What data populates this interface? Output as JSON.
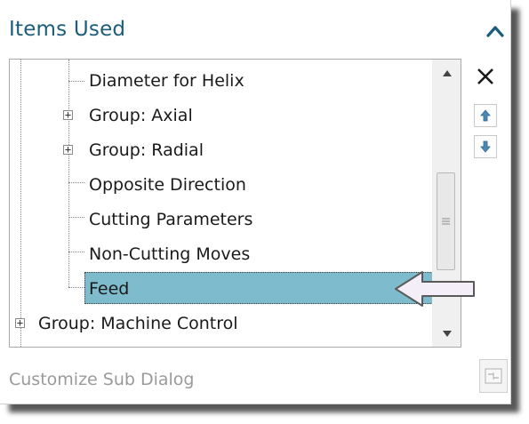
{
  "panel": {
    "title": "Items Used"
  },
  "tree": {
    "items": [
      {
        "label": "Diameter for Helix",
        "expandable": false
      },
      {
        "label": "Group: Axial",
        "expandable": true
      },
      {
        "label": "Group: Radial",
        "expandable": true
      },
      {
        "label": "Opposite Direction",
        "expandable": false
      },
      {
        "label": "Cutting Parameters",
        "expandable": false
      },
      {
        "label": "Non-Cutting Moves",
        "expandable": false
      },
      {
        "label": "Feed",
        "expandable": false,
        "selected": true
      },
      {
        "label": "Group: Machine Control",
        "expandable": true
      }
    ]
  },
  "footer": {
    "customize_label": "Customize Sub Dialog"
  },
  "icons": {
    "collapse": "chevron-up-icon",
    "remove": "close-icon",
    "move_up": "arrow-up-icon",
    "move_down": "arrow-down-icon",
    "customize": "dialog-icon",
    "pointer": "arrow-left-callout"
  },
  "colors": {
    "title": "#1b5d7b",
    "selection": "#7ebbcc",
    "move_arrows": "#4a88b8"
  }
}
